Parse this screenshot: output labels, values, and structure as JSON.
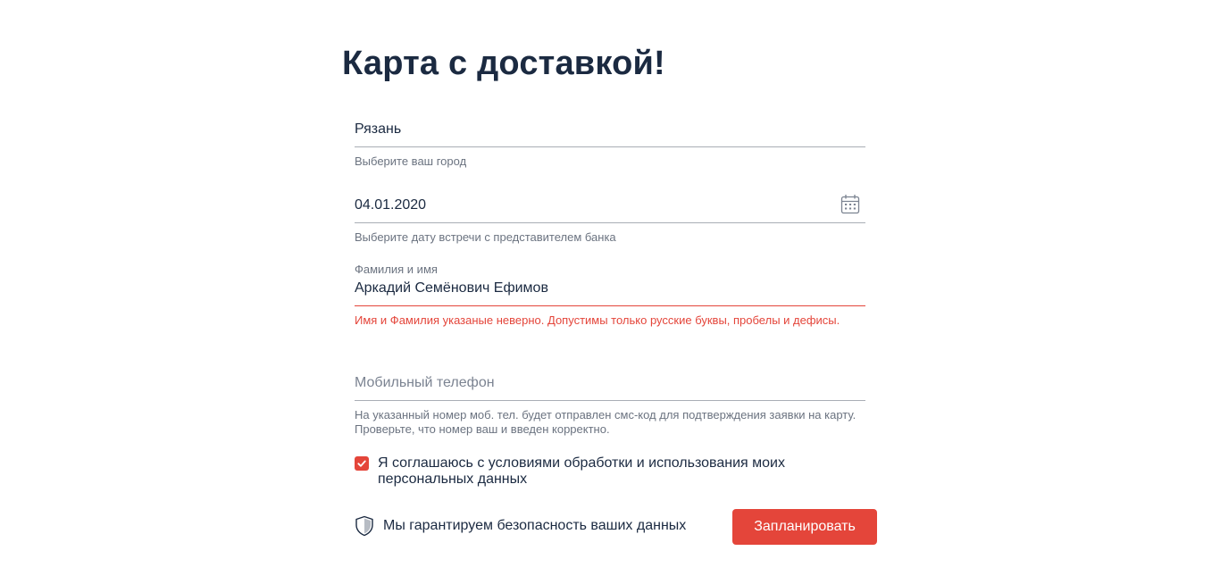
{
  "page": {
    "title": "Карта с доставкой!"
  },
  "form": {
    "city": {
      "value": "Рязань",
      "hint": "Выберите ваш город"
    },
    "date": {
      "value": "04.01.2020",
      "hint": "Выберите дату встречи с представителем банка",
      "icon": "calendar-icon"
    },
    "name": {
      "label": "Фамилия и имя",
      "value": "Аркадий Семёнович Ефимов",
      "error": "Имя и Фамилия указаные неверно. Допустимы только русские буквы, пробелы и дефисы."
    },
    "phone": {
      "placeholder": "Мобильный телефон",
      "hint": "На указанный номер моб. тел. будет отправлен смс-код для подтверждения заявки на карту. Проверьте, что номер ваш и введен корректно."
    },
    "agreement": {
      "checked": true,
      "label": "Я соглашаюсь с условиями обработки и использования моих персональных данных"
    },
    "security": {
      "icon": "shield-icon",
      "text": "Мы гарантируем безопасность ваших данных"
    },
    "submit_label": "Запланировать"
  },
  "colors": {
    "accent": "#e4453a",
    "text": "#1b2a41",
    "hint": "#6b7380",
    "line": "#a9aeb5"
  }
}
